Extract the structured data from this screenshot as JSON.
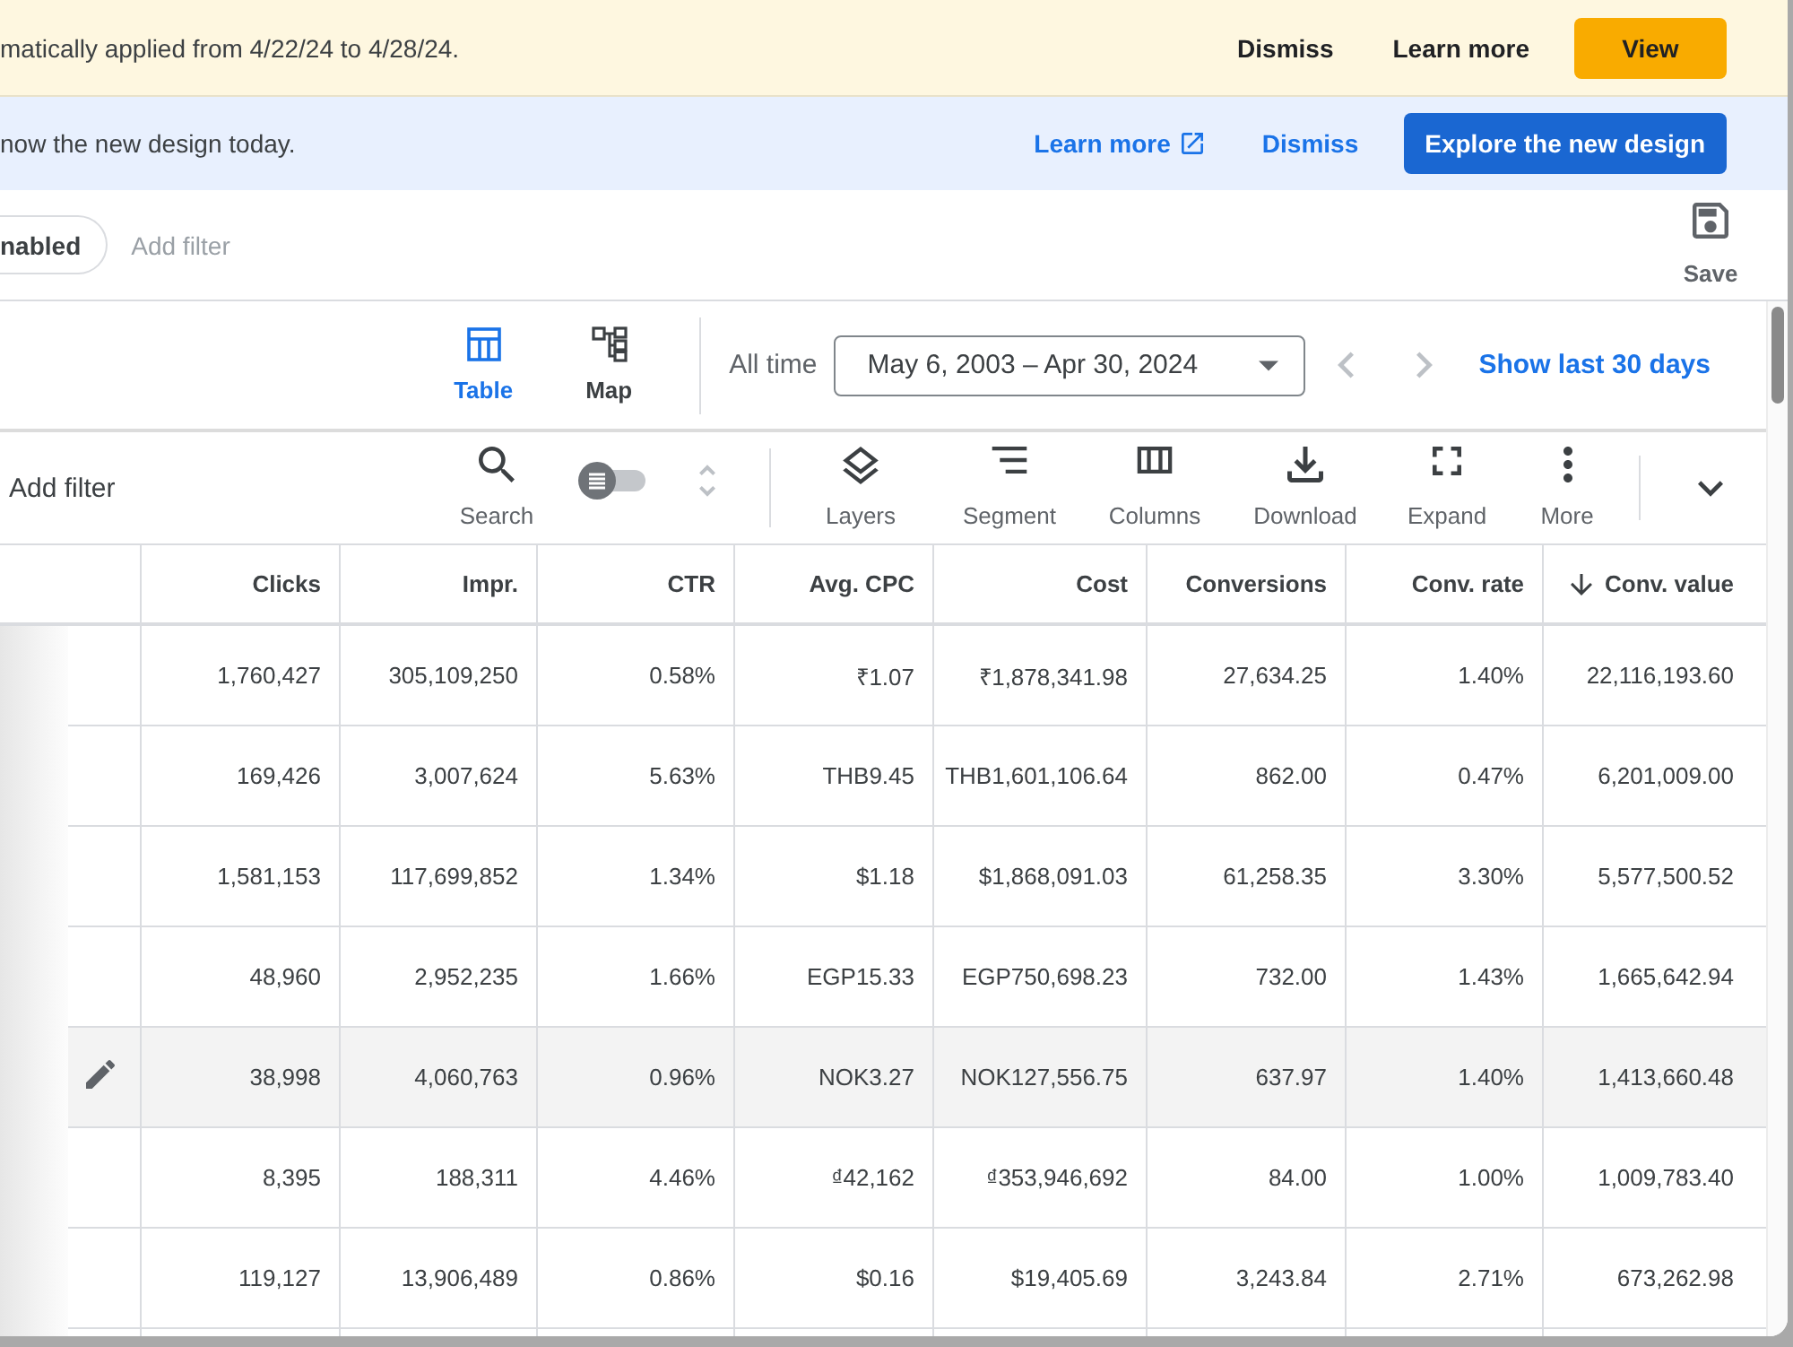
{
  "banners": [
    {
      "kind": "warning",
      "text": "matically applied from 4/22/24 to 4/28/24.",
      "actions": [
        {
          "kind": "plain",
          "label": "Dismiss"
        },
        {
          "kind": "plain",
          "label": "Learn more"
        },
        {
          "kind": "primary",
          "label": "View"
        }
      ]
    },
    {
      "kind": "info",
      "text": "now the new design today.",
      "actions": [
        {
          "kind": "external",
          "label": "Learn more"
        },
        {
          "kind": "link",
          "label": "Dismiss"
        },
        {
          "kind": "primary",
          "label": "Explore the new design"
        }
      ]
    }
  ],
  "filter_bar": {
    "chip": "nabled",
    "add_filter": "Add filter",
    "save": "Save"
  },
  "views": [
    {
      "label": "Table",
      "selected": true
    },
    {
      "label": "Map",
      "selected": false
    }
  ],
  "date_range": {
    "label": "All time",
    "value": "May 6, 2003 – Apr 30, 2024",
    "shortcut": "Show last 30 days"
  },
  "toolbar": {
    "add_filter": "Add filter",
    "search": "Search",
    "toggle": {
      "on": false
    },
    "tools": [
      "Layers",
      "Segment",
      "Columns",
      "Download",
      "Expand",
      "More"
    ]
  },
  "table": {
    "columns": [
      {
        "label": "Clicks",
        "sorted": false
      },
      {
        "label": "Impr.",
        "sorted": false
      },
      {
        "label": "CTR",
        "sorted": false
      },
      {
        "label": "Avg. CPC",
        "sorted": false
      },
      {
        "label": "Cost",
        "sorted": false
      },
      {
        "label": "Conversions",
        "sorted": false
      },
      {
        "label": "Conv. rate",
        "sorted": false
      },
      {
        "label": "Conv. value",
        "sorted": true
      }
    ],
    "rows": [
      {
        "highlighted": false,
        "cells": [
          "1,760,427",
          "305,109,250",
          "0.58%",
          "₹1.07",
          "₹1,878,341.98",
          "27,634.25",
          "1.40%",
          "22,116,193.60"
        ]
      },
      {
        "highlighted": false,
        "cells": [
          "169,426",
          "3,007,624",
          "5.63%",
          "THB9.45",
          "THB1,601,106.64",
          "862.00",
          "0.47%",
          "6,201,009.00"
        ]
      },
      {
        "highlighted": false,
        "cells": [
          "1,581,153",
          "117,699,852",
          "1.34%",
          "$1.18",
          "$1,868,091.03",
          "61,258.35",
          "3.30%",
          "5,577,500.52"
        ]
      },
      {
        "highlighted": false,
        "cells": [
          "48,960",
          "2,952,235",
          "1.66%",
          "EGP15.33",
          "EGP750,698.23",
          "732.00",
          "1.43%",
          "1,665,642.94"
        ]
      },
      {
        "highlighted": true,
        "cells": [
          "38,998",
          "4,060,763",
          "0.96%",
          "NOK3.27",
          "NOK127,556.75",
          "637.97",
          "1.40%",
          "1,413,660.48"
        ]
      },
      {
        "highlighted": false,
        "cells": [
          "8,395",
          "188,311",
          "4.46%",
          "₫42,162",
          "₫353,946,692",
          "84.00",
          "1.00%",
          "1,009,783.40"
        ]
      },
      {
        "highlighted": false,
        "cells": [
          "119,127",
          "13,906,489",
          "0.86%",
          "$0.16",
          "$19,405.69",
          "3,243.84",
          "2.71%",
          "673,262.98"
        ]
      }
    ]
  }
}
